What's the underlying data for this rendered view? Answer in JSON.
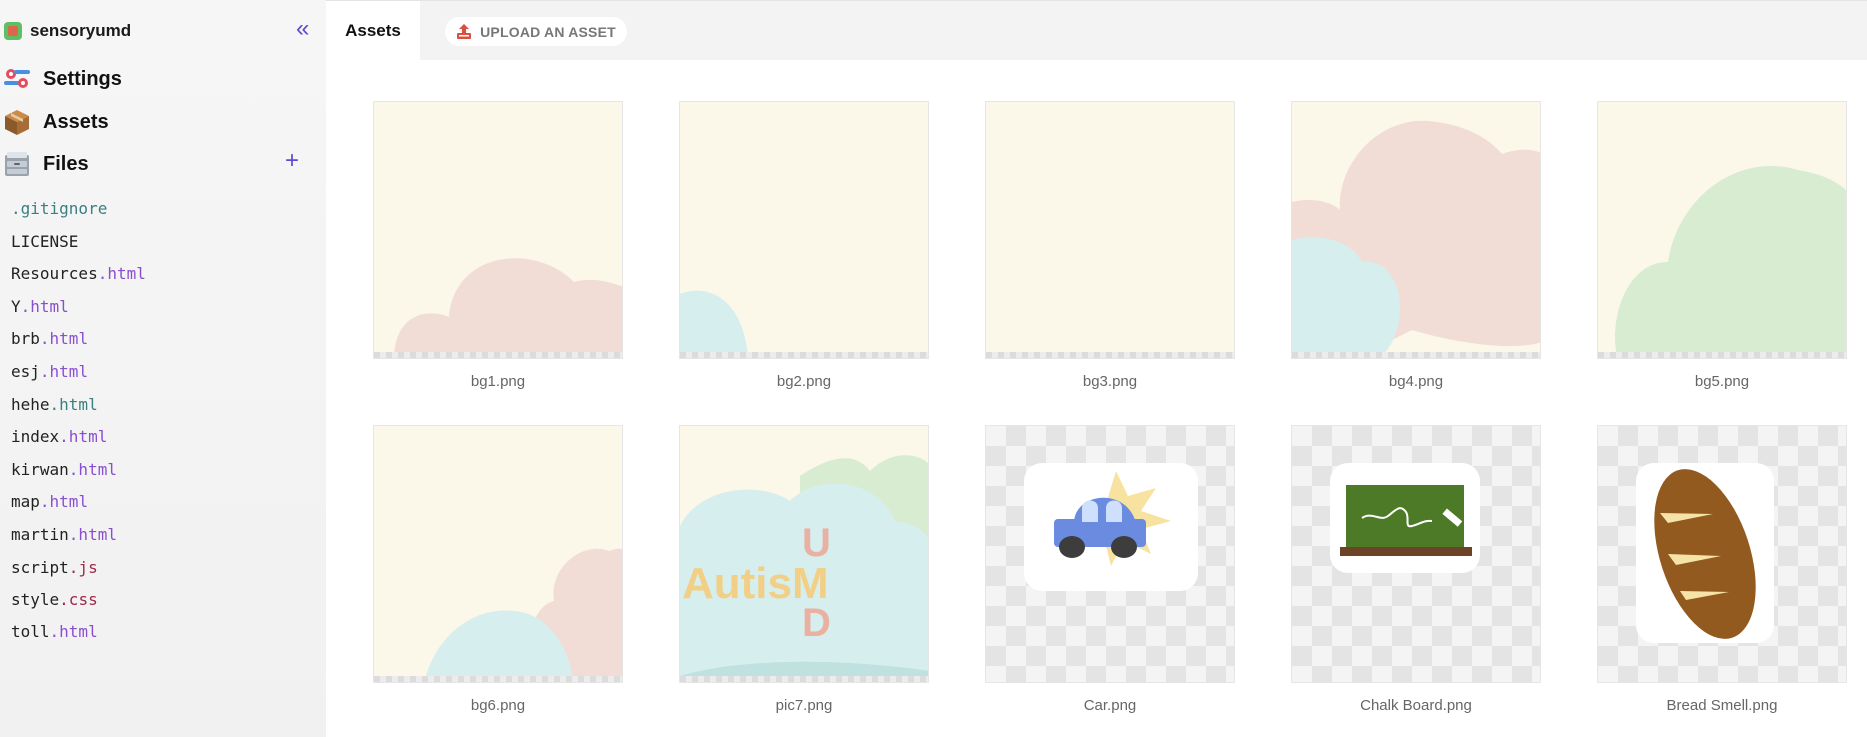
{
  "sidebar": {
    "project_name": "sensoryumd",
    "collapse_glyph": "«",
    "nav": [
      {
        "label": "Settings",
        "icon": "settings-icon"
      },
      {
        "label": "Assets",
        "icon": "assets-box-icon"
      },
      {
        "label": "Files",
        "icon": "files-cabinet-icon"
      }
    ],
    "files_add_glyph": "+",
    "files": [
      {
        "base": ".gitignore",
        "ext": ""
      },
      {
        "base": "LICENSE",
        "ext": ""
      },
      {
        "base": "Resources",
        "ext": ".html"
      },
      {
        "base": "Y",
        "ext": ".html"
      },
      {
        "base": "brb",
        "ext": ".html"
      },
      {
        "base": "esj",
        "ext": ".html"
      },
      {
        "base": "hehe",
        "ext": ".html"
      },
      {
        "base": "index",
        "ext": ".html"
      },
      {
        "base": "kirwan",
        "ext": ".html"
      },
      {
        "base": "map",
        "ext": ".html"
      },
      {
        "base": "martin",
        "ext": ".html"
      },
      {
        "base": "script",
        "ext": ".js"
      },
      {
        "base": "style",
        "ext": ".css"
      },
      {
        "base": "toll",
        "ext": ".html"
      }
    ]
  },
  "topbar": {
    "tab_label": "Assets",
    "upload_label": "UPLOAD AN ASSET"
  },
  "assets": [
    {
      "name": "bg1.png"
    },
    {
      "name": "bg2.png"
    },
    {
      "name": "bg3.png"
    },
    {
      "name": "bg4.png"
    },
    {
      "name": "bg5.png"
    },
    {
      "name": "bg6.png"
    },
    {
      "name": "pic7.png",
      "art_text": "AutisM",
      "art_letters": [
        "U",
        "D"
      ]
    },
    {
      "name": "Car.png"
    },
    {
      "name": "Chalk Board.png"
    },
    {
      "name": "Bread Smell.png"
    }
  ],
  "colors": {
    "accent": "#5b4bd5",
    "html_ext": "#8a4fd1",
    "js_css_ext": "#a0294a"
  }
}
